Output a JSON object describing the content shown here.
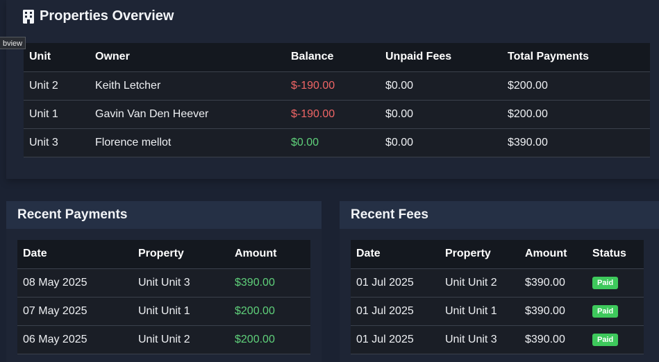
{
  "overview": {
    "title": "Properties Overview",
    "icon": "building-icon",
    "columns": [
      "Unit",
      "Owner",
      "Balance",
      "Unpaid Fees",
      "Total Payments"
    ],
    "rows": [
      {
        "unit": "Unit 2",
        "owner": "Keith Letcher",
        "balance": "$-190.00",
        "unpaid": "$0.00",
        "total": "$200.00"
      },
      {
        "unit": "Unit 1",
        "owner": "Gavin Van Den Heever",
        "balance": "$-190.00",
        "unpaid": "$0.00",
        "total": "$200.00"
      },
      {
        "unit": "Unit 3",
        "owner": "Florence mellot",
        "balance": "$0.00",
        "unpaid": "$0.00",
        "total": "$390.00"
      }
    ]
  },
  "tooltip": {
    "text": "bview"
  },
  "payments": {
    "title": "Recent Payments",
    "columns": [
      "Date",
      "Property",
      "Amount"
    ],
    "rows": [
      {
        "date": "08 May 2025",
        "property": "Unit Unit 3",
        "amount": "$390.00"
      },
      {
        "date": "07 May 2025",
        "property": "Unit Unit 1",
        "amount": "$200.00"
      },
      {
        "date": "06 May 2025",
        "property": "Unit Unit 2",
        "amount": "$200.00"
      }
    ]
  },
  "fees": {
    "title": "Recent Fees",
    "columns": [
      "Date",
      "Property",
      "Amount",
      "Status"
    ],
    "rows": [
      {
        "date": "01 Jul 2025",
        "property": "Unit Unit 2",
        "amount": "$390.00",
        "status": "Paid"
      },
      {
        "date": "01 Jul 2025",
        "property": "Unit Unit 1",
        "amount": "$390.00",
        "status": "Paid"
      },
      {
        "date": "01 Jul 2025",
        "property": "Unit Unit 3",
        "amount": "$390.00",
        "status": "Paid"
      }
    ]
  },
  "colors": {
    "background": "#1b2232",
    "negative": "#ef6565",
    "positive": "#5fd07a",
    "badge": "#3ec95c"
  }
}
